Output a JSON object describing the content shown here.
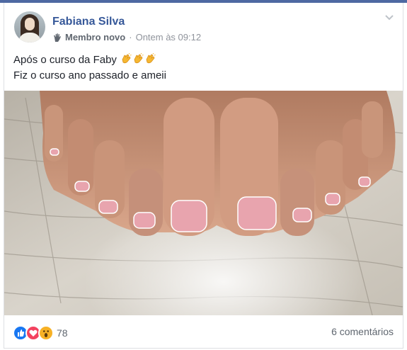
{
  "post": {
    "author": "Fabiana Silva",
    "badge": "Membro novo",
    "separator": "·",
    "timestamp": "Ontem às 09:12",
    "text_line1": "Após o curso da Faby",
    "text_line2": "Fiz o curso ano passado e ameii",
    "emoji": [
      "clapping-hands",
      "clapping-hands",
      "clapping-hands"
    ]
  },
  "footer": {
    "reactions": [
      "like",
      "love",
      "wow"
    ],
    "reaction_count": "78",
    "comments": "6 comentários"
  },
  "colors": {
    "link": "#365899",
    "muted": "#90949c",
    "like": "#1877f2",
    "love": "#f3425f",
    "wow": "#f7b125"
  }
}
